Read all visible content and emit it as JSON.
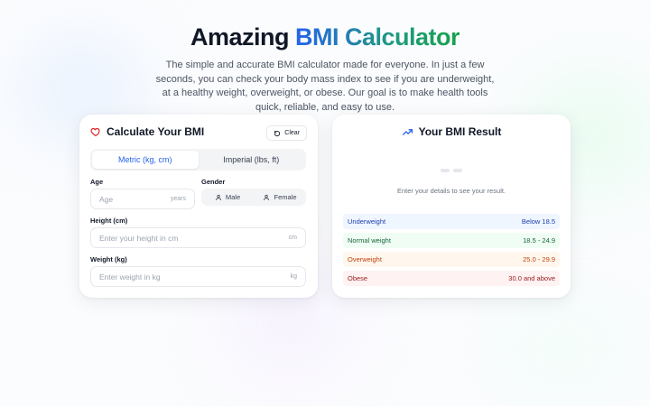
{
  "hero": {
    "title_prefix": "Amazing",
    "title_accent": "BMI Calculator",
    "subtitle": "The simple and accurate BMI calculator made for everyone. In just a few seconds, you can check your body mass index to see if you are underweight, at a healthy weight, overweight, or obese. Our goal is to make health tools quick, reliable, and easy to use."
  },
  "calculator": {
    "title": "Calculate Your BMI",
    "heart_icon": "heart-icon",
    "clear_label": "Clear",
    "tabs": [
      {
        "label": "Metric (kg, cm)",
        "active": true
      },
      {
        "label": "Imperial (lbs, ft)",
        "active": false
      }
    ],
    "age": {
      "label": "Age",
      "placeholder": "Age",
      "unit": "years"
    },
    "gender": {
      "label": "Gender",
      "options": [
        "Male",
        "Female"
      ]
    },
    "height": {
      "label": "Height (cm)",
      "placeholder": "Enter your height in cm",
      "unit": "cm"
    },
    "weight": {
      "label": "Weight (kg)",
      "placeholder": "Enter weight in kg",
      "unit": "kg"
    }
  },
  "result": {
    "title": "Your BMI Result",
    "hint": "Enter your details to see your result.",
    "ranges": [
      {
        "name": "Underweight",
        "value": "Below 18.5",
        "bg": "#eff6ff",
        "color": "#1e40af"
      },
      {
        "name": "Normal weight",
        "value": "18.5 - 24.9",
        "bg": "#f0fdf4",
        "color": "#166534"
      },
      {
        "name": "Overweight",
        "value": "25.0 - 29.9",
        "bg": "#fff7ed",
        "color": "#c2410c"
      },
      {
        "name": "Obese",
        "value": "30.0 and above",
        "bg": "#fef2f2",
        "color": "#991b1b"
      }
    ]
  },
  "colors": {
    "accent_blue": "#2563eb",
    "accent_green": "#16a34a",
    "heart": "#dc2626"
  }
}
